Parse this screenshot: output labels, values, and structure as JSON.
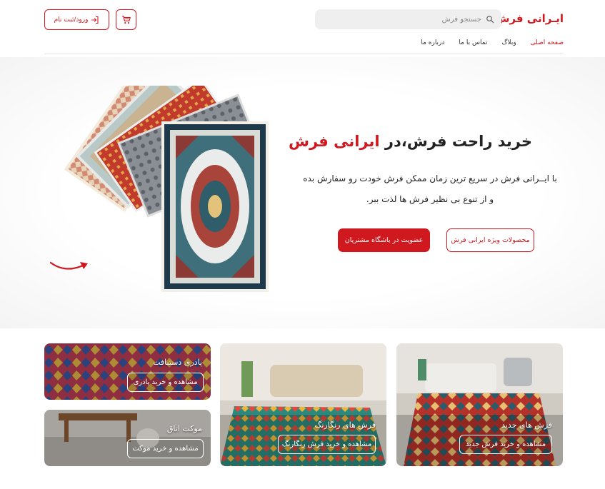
{
  "header": {
    "logo": "ایـرانی فرش",
    "search_placeholder": "جستجو فرش",
    "login_label": "ورود/ثبت نام",
    "icons": {
      "search": "search-icon",
      "cart": "cart-icon",
      "login": "login-arrow-icon"
    }
  },
  "nav": {
    "items": [
      "صفحه اصلی",
      "وبلاگ",
      "تماس با ما",
      "درباره ما"
    ]
  },
  "hero": {
    "title_main": "خرید راحت فرش،در ",
    "title_accent": "ایرانی فرش",
    "desc_line1": "با ایــرانی فرش در سریع ترین زمان ممکن فرش خودت رو سفارش بده",
    "desc_line2": "و از تنوع بی نظیر فرش ها لذت ببر.",
    "btn_products": "محصولات ویژه ایرانی فرش",
    "btn_club": "عضویت در باشگاه مشتریان"
  },
  "categories": [
    {
      "title": "فرش های جدید",
      "button": "مشاهده و خرید فرش جدید"
    },
    {
      "title": "فرش های رنگارنگ",
      "button": "مشاهده و خرید فرش رنگارنگ"
    },
    {
      "title": "پادری دستبافت",
      "button": "مشاهده و خرید پادری"
    },
    {
      "title": "موکت اتاق",
      "button": "مشاهده و خرید موکت"
    }
  ],
  "colors": {
    "accent": "#d0191f",
    "text": "#222222",
    "search_bg": "#efefef"
  }
}
